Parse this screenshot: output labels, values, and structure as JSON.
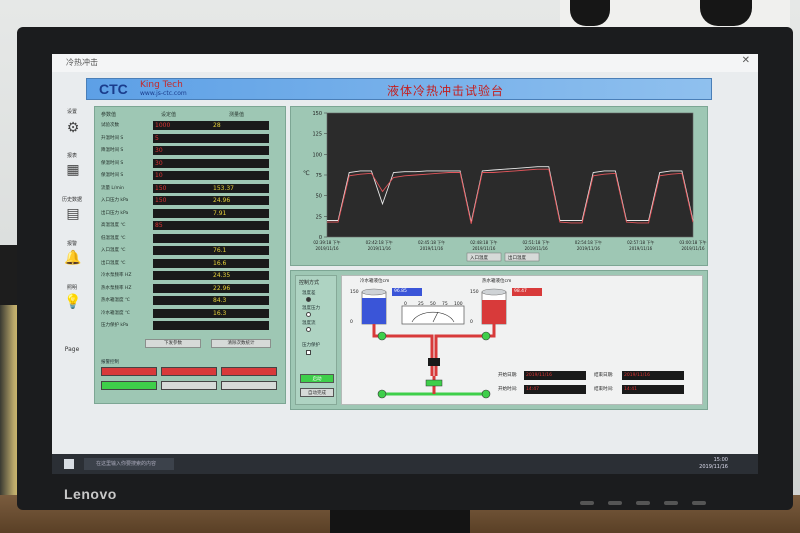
{
  "monitor": {
    "brand": "Lenovo"
  },
  "app": {
    "window_title": "冷热冲击",
    "close_glyph": "✕",
    "logo": "CTC",
    "logo_sub": "King  Tech",
    "logo_url": "www.js-ctc.com",
    "title": "液体冷热冲击试验台"
  },
  "nav": [
    {
      "label": "设置",
      "icon": "gear-icon",
      "glyph": "⚙"
    },
    {
      "label": "报表",
      "icon": "report-icon",
      "glyph": "▦"
    },
    {
      "label": "历史数据",
      "icon": "history-icon",
      "glyph": "▤"
    },
    {
      "label": "报警",
      "icon": "bell-icon",
      "glyph": "🔔"
    },
    {
      "label": "照明",
      "icon": "bulb-icon",
      "glyph": "💡"
    }
  ],
  "page_label": "Page",
  "left_panel": {
    "col_param": "参数值",
    "col_set": "设定值",
    "col_measured": "测量值",
    "rows": [
      {
        "label": "试验次数",
        "set": "1000",
        "measured": "28"
      },
      {
        "label": "升温时间 S",
        "set": "5",
        "measured": ""
      },
      {
        "label": "降温时间 S",
        "set": "30",
        "measured": ""
      },
      {
        "label": "保温时间 S",
        "set": "30",
        "measured": ""
      },
      {
        "label": "保温时间 S",
        "set": "10",
        "measured": ""
      },
      {
        "label": "流量 L/min",
        "set": "150",
        "measured": "153.37"
      },
      {
        "label": "入口压力 kPa",
        "set": "150",
        "measured": "24.96"
      },
      {
        "label": "出口压力 kPa",
        "set": "",
        "measured": "7.91"
      },
      {
        "label": "高温温度 ℃",
        "set": "85",
        "measured": ""
      },
      {
        "label": "低温温度 ℃",
        "set": "",
        "measured": ""
      },
      {
        "label": "入口温度 ℃",
        "set": "",
        "measured": "76.1"
      },
      {
        "label": "出口温度 ℃",
        "set": "",
        "measured": "16.6"
      },
      {
        "label": "冷水泵频率 HZ",
        "set": "",
        "measured": "24.35"
      },
      {
        "label": "热水泵频率 HZ",
        "set": "",
        "measured": "22.96"
      },
      {
        "label": "热水箱温度 ℃",
        "set": "",
        "measured": "84.3"
      },
      {
        "label": "冷水箱温度 ℃",
        "set": "",
        "measured": "16.3"
      },
      {
        "label": "压力保护 kPa",
        "set": "",
        "measured": ""
      }
    ],
    "btn_download": "下发参数",
    "btn_clear": "清除次数统计",
    "alarm_title": "报警控制",
    "alarms": [
      "",
      "",
      "",
      "",
      "",
      ""
    ]
  },
  "chart_data": {
    "type": "line",
    "ylim": [
      0,
      150
    ],
    "yticks": [
      0,
      25,
      50,
      75,
      100,
      125,
      150
    ],
    "ylabel": "℃",
    "xticks": [
      {
        "time": "02:39:18 下午",
        "date": "2019/11/16"
      },
      {
        "time": "02:42:18 下午",
        "date": "2019/11/16"
      },
      {
        "time": "02:45:18 下午",
        "date": "2019/11/16"
      },
      {
        "time": "02:48:18 下午",
        "date": "2019/11/16"
      },
      {
        "time": "02:51:18 下午",
        "date": "2019/11/16"
      },
      {
        "time": "02:54:18 下午",
        "date": "2019/11/16"
      },
      {
        "time": "02:57:18 下午",
        "date": "2019/11/16"
      },
      {
        "time": "03:00:18 下午",
        "date": "2019/11/16"
      }
    ],
    "legend": [
      "入口温度",
      "出口温度"
    ],
    "series": [
      {
        "name": "入口温度",
        "color": "#e8e8e8",
        "values": [
          20,
          20,
          78,
          80,
          80,
          40,
          78,
          79,
          79,
          80,
          80,
          80,
          80,
          18,
          80,
          81,
          82,
          83,
          84,
          85,
          85,
          20,
          20,
          20,
          78,
          80,
          80,
          20,
          20,
          20,
          78,
          80,
          80,
          20
        ]
      },
      {
        "name": "出口温度",
        "color": "#e2555a",
        "values": [
          18,
          18,
          74,
          76,
          77,
          55,
          72,
          74,
          75,
          76,
          77,
          78,
          78,
          16,
          78,
          78,
          79,
          80,
          81,
          82,
          82,
          18,
          17,
          17,
          74,
          76,
          77,
          18,
          17,
          17,
          74,
          76,
          77,
          18
        ]
      }
    ]
  },
  "control": {
    "title": "控制方式",
    "options": [
      "温度差",
      "温度压力",
      "温度流"
    ],
    "protect": "压力保护",
    "start": "启动",
    "stop": "自动完成"
  },
  "diagram": {
    "cold_label": "冷水箱液位cm",
    "hot_label": "热水箱液位cm",
    "cold_value": "96.85",
    "hot_value": "98.47",
    "gauge_ticks": [
      "0",
      "25",
      "50",
      "75",
      "100"
    ],
    "scale_150": "150",
    "scale_100": "100",
    "scale_50": "50",
    "scale_0": "0",
    "start_date_label": "开始日期:",
    "start_date": "2019/11/16",
    "end_date_label": "结束日期:",
    "end_date": "2019/11/16",
    "start_time_label": "开始时间:",
    "start_time": "14:47",
    "end_time_label": "结束时间:",
    "end_time": "14:41"
  },
  "taskbar": {
    "search": "在这里输入你要搜索的内容",
    "time": "15:00",
    "date": "2019/11/16"
  }
}
